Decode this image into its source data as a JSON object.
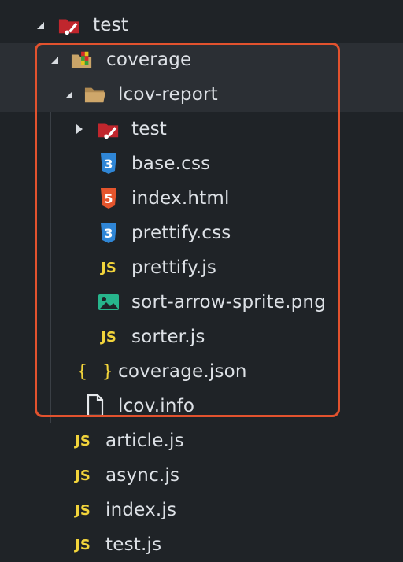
{
  "tree": {
    "root": {
      "label": "test",
      "icon": "test-folder-icon",
      "expanded": true
    },
    "coverage": {
      "label": "coverage",
      "icon": "coverage-folder-icon",
      "expanded": true
    },
    "lcov_report": {
      "label": "lcov-report",
      "icon": "folder-open-icon",
      "expanded": true
    },
    "lcov_children": [
      {
        "label": "test",
        "icon": "test-folder-icon",
        "expanded": false
      },
      {
        "label": "base.css",
        "icon": "css-icon"
      },
      {
        "label": "index.html",
        "icon": "html-icon"
      },
      {
        "label": "prettify.css",
        "icon": "css-icon"
      },
      {
        "label": "prettify.js",
        "icon": "js-icon"
      },
      {
        "label": "sort-arrow-sprite.png",
        "icon": "image-icon"
      },
      {
        "label": "sorter.js",
        "icon": "js-icon"
      }
    ],
    "coverage_files": [
      {
        "label": "coverage.json",
        "icon": "json-icon"
      },
      {
        "label": "lcov.info",
        "icon": "file-icon"
      }
    ],
    "test_files": [
      {
        "label": "article.js",
        "icon": "js-icon"
      },
      {
        "label": "async.js",
        "icon": "js-icon"
      },
      {
        "label": "index.js",
        "icon": "js-icon"
      },
      {
        "label": "test.js",
        "icon": "js-icon"
      }
    ],
    "js_badge": "JS",
    "json_badge": "{ }",
    "css_badge": "3",
    "html_badge": "5"
  },
  "colors": {
    "background": "#1f2327",
    "selection": "#2b2f34",
    "highlight_border": "#e2522e",
    "js_yellow": "#f2d43b",
    "css_blue": "#2f86d6",
    "html_orange": "#e4552d",
    "image_green": "#27b58c"
  }
}
